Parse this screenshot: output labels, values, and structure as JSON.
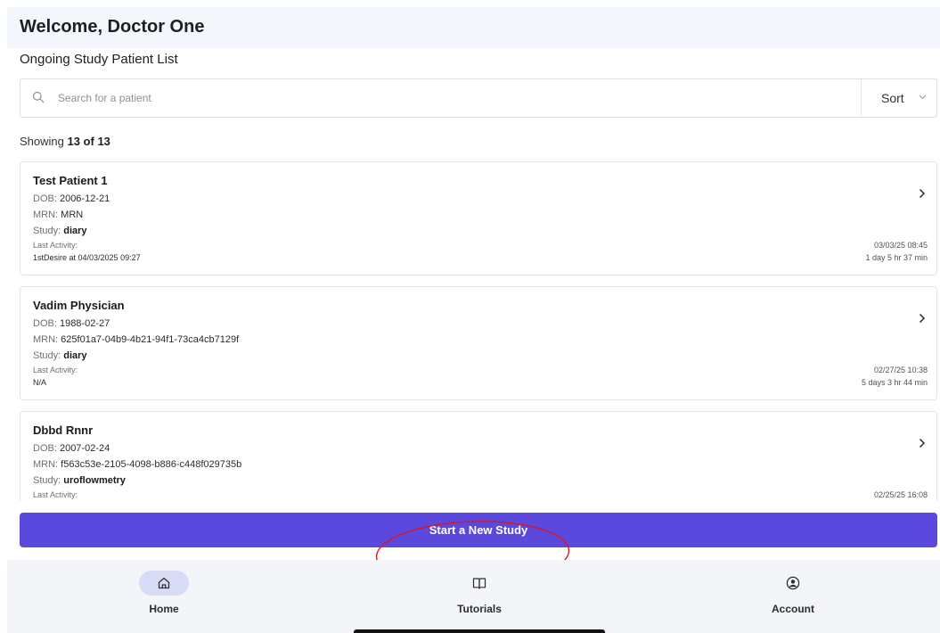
{
  "header": {
    "welcome": "Welcome, Doctor One",
    "subtitle": "Ongoing Study Patient List"
  },
  "search": {
    "placeholder": "Search for a patient",
    "value": ""
  },
  "sort": {
    "label": "Sort"
  },
  "summary": {
    "prefix": "Showing ",
    "count": "13 of 13"
  },
  "labels": {
    "dob": "DOB: ",
    "mrn": "MRN: ",
    "study": "Study: ",
    "last_activity": "Last Activity:"
  },
  "patients": [
    {
      "name": "Test Patient 1",
      "dob": "2006-12-21",
      "mrn": "MRN",
      "study": "diary",
      "last_activity": "1stDesire at 04/03/2025 09:27",
      "date": "03/03/25 08:45",
      "elapsed": "1 day 5 hr 37 min"
    },
    {
      "name": "Vadim Physician",
      "dob": "1988-02-27",
      "mrn": "625f01a7-04b9-4b21-94f1-73ca4cb7129f",
      "study": "diary",
      "last_activity": "N/A",
      "date": "02/27/25 10:38",
      "elapsed": "5 days 3 hr 44 min"
    },
    {
      "name": "Dbbd Rnnr",
      "dob": "2007-02-24",
      "mrn": "f563c53e-2105-4098-b886-c448f029735b",
      "study": "uroflowmetry",
      "last_activity": "",
      "date": "02/25/25 16:08",
      "elapsed": ""
    }
  ],
  "actions": {
    "start_study": "Start a New Study"
  },
  "nav": {
    "items": [
      {
        "label": "Home",
        "icon": "home-icon",
        "active": true
      },
      {
        "label": "Tutorials",
        "icon": "book-icon",
        "active": false
      },
      {
        "label": "Account",
        "icon": "user-circle-icon",
        "active": false
      }
    ]
  },
  "colors": {
    "accent": "#5b48dc",
    "header_bg": "#f3f7fb",
    "nav_bg": "#f3f5f8",
    "annotation": "#e0141c"
  }
}
